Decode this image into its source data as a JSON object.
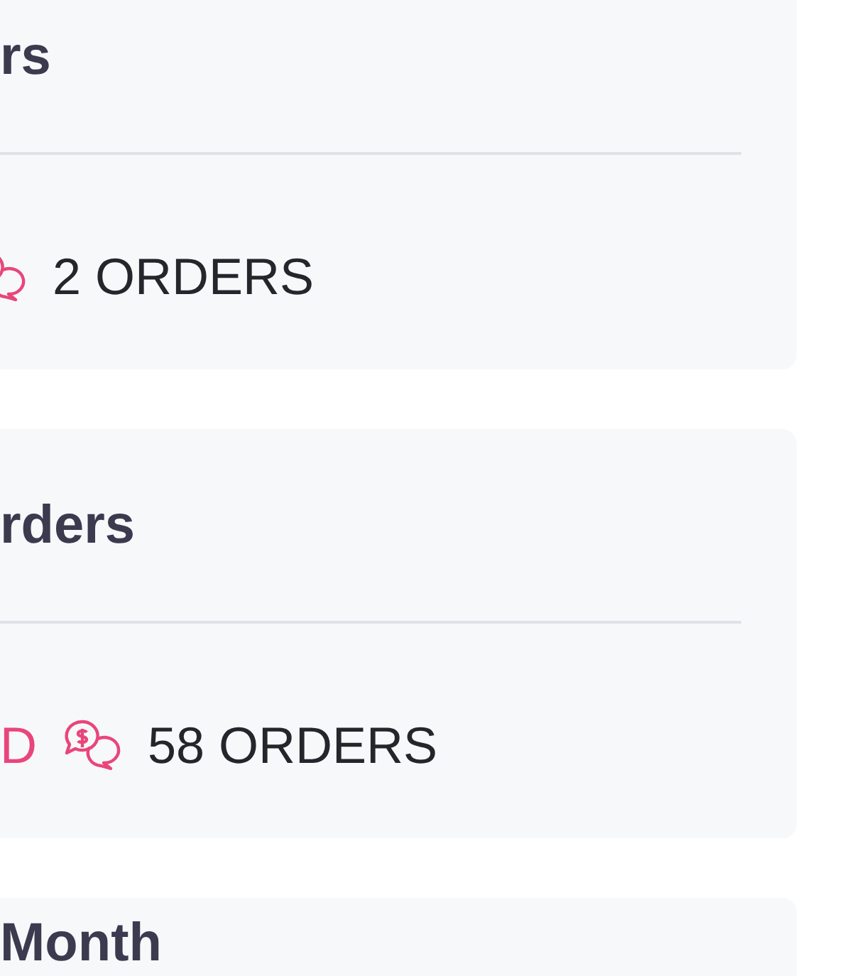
{
  "cards": [
    {
      "title": "rs",
      "orders": "2 ORDERS"
    },
    {
      "title": "rders",
      "status": "D",
      "orders": "58 ORDERS"
    },
    {
      "title": "Month"
    }
  ]
}
